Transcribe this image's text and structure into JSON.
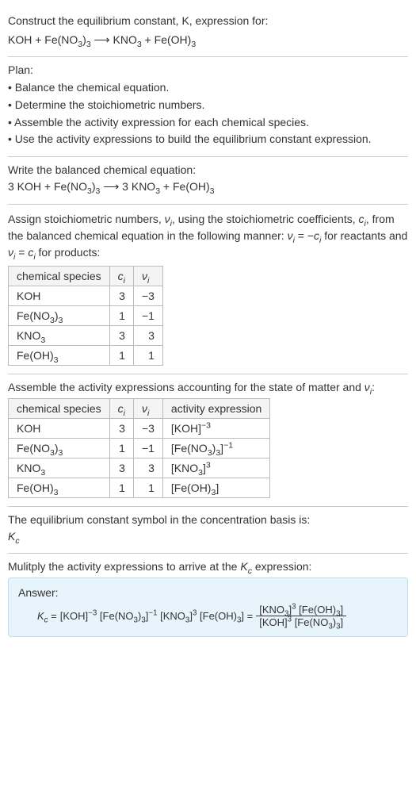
{
  "header": {
    "prompt": "Construct the equilibrium constant, K, expression for:",
    "equation_html": "KOH + Fe(NO<sub>3</sub>)<sub>3</sub> ⟶ KNO<sub>3</sub> + Fe(OH)<sub>3</sub>"
  },
  "plan": {
    "title": "Plan:",
    "items": [
      "• Balance the chemical equation.",
      "• Determine the stoichiometric numbers.",
      "• Assemble the activity expression for each chemical species.",
      "• Use the activity expressions to build the equilibrium constant expression."
    ]
  },
  "balanced": {
    "intro": "Write the balanced chemical equation:",
    "equation_html": "3 KOH + Fe(NO<sub>3</sub>)<sub>3</sub> ⟶ 3 KNO<sub>3</sub> + Fe(OH)<sub>3</sub>"
  },
  "assign": {
    "intro_html": "Assign stoichiometric numbers, <span class='ital'>ν<sub>i</sub></span>, using the stoichiometric coefficients, <span class='ital'>c<sub>i</sub></span>, from the balanced chemical equation in the following manner: <span class='ital'>ν<sub>i</sub></span> = −<span class='ital'>c<sub>i</sub></span> for reactants and <span class='ital'>ν<sub>i</sub></span> = <span class='ital'>c<sub>i</sub></span> for products:",
    "headers": {
      "species": "chemical species",
      "ci_html": "<span class='ital'>c<sub>i</sub></span>",
      "vi_html": "<span class='ital'>ν<sub>i</sub></span>"
    },
    "rows": [
      {
        "species_html": "KOH",
        "ci": "3",
        "vi": "−3"
      },
      {
        "species_html": "Fe(NO<sub>3</sub>)<sub>3</sub>",
        "ci": "1",
        "vi": "−1"
      },
      {
        "species_html": "KNO<sub>3</sub>",
        "ci": "3",
        "vi": "3"
      },
      {
        "species_html": "Fe(OH)<sub>3</sub>",
        "ci": "1",
        "vi": "1"
      }
    ]
  },
  "activity": {
    "intro_html": "Assemble the activity expressions accounting for the state of matter and <span class='ital'>ν<sub>i</sub></span>:",
    "headers": {
      "species": "chemical species",
      "ci_html": "<span class='ital'>c<sub>i</sub></span>",
      "vi_html": "<span class='ital'>ν<sub>i</sub></span>",
      "expr": "activity expression"
    },
    "rows": [
      {
        "species_html": "KOH",
        "ci": "3",
        "vi": "−3",
        "expr_html": "[KOH]<sup>−3</sup>"
      },
      {
        "species_html": "Fe(NO<sub>3</sub>)<sub>3</sub>",
        "ci": "1",
        "vi": "−1",
        "expr_html": "[Fe(NO<sub>3</sub>)<sub>3</sub>]<sup>−1</sup>"
      },
      {
        "species_html": "KNO<sub>3</sub>",
        "ci": "3",
        "vi": "3",
        "expr_html": "[KNO<sub>3</sub>]<sup>3</sup>"
      },
      {
        "species_html": "Fe(OH)<sub>3</sub>",
        "ci": "1",
        "vi": "1",
        "expr_html": "[Fe(OH)<sub>3</sub>]"
      }
    ]
  },
  "kc_symbol": {
    "intro": "The equilibrium constant symbol in the concentration basis is:",
    "symbol_html": "<span class='ital'>K<sub>c</sub></span>"
  },
  "multiply": {
    "intro_html": "Mulitply the activity expressions to arrive at the <span class='ital'>K<sub>c</sub></span> expression:"
  },
  "answer": {
    "label": "Answer:",
    "lhs_html": "<span class='ital'>K<sub>c</sub></span> =",
    "flat_html": "[KOH]<sup>−3</sup> [Fe(NO<sub>3</sub>)<sub>3</sub>]<sup>−1</sup> [KNO<sub>3</sub>]<sup>3</sup> [Fe(OH)<sub>3</sub>] =",
    "frac_num_html": "[KNO<sub>3</sub>]<sup>3</sup> [Fe(OH)<sub>3</sub>]",
    "frac_den_html": "[KOH]<sup>3</sup> [Fe(NO<sub>3</sub>)<sub>3</sub>]"
  },
  "chart_data": {
    "type": "table",
    "tables": [
      {
        "title": "Stoichiometric numbers",
        "columns": [
          "chemical species",
          "c_i",
          "ν_i"
        ],
        "rows": [
          [
            "KOH",
            3,
            -3
          ],
          [
            "Fe(NO3)3",
            1,
            -1
          ],
          [
            "KNO3",
            3,
            3
          ],
          [
            "Fe(OH)3",
            1,
            1
          ]
        ]
      },
      {
        "title": "Activity expressions",
        "columns": [
          "chemical species",
          "c_i",
          "ν_i",
          "activity expression"
        ],
        "rows": [
          [
            "KOH",
            3,
            -3,
            "[KOH]^-3"
          ],
          [
            "Fe(NO3)3",
            1,
            -1,
            "[Fe(NO3)3]^-1"
          ],
          [
            "KNO3",
            3,
            3,
            "[KNO3]^3"
          ],
          [
            "Fe(OH)3",
            1,
            1,
            "[Fe(OH)3]"
          ]
        ]
      }
    ]
  }
}
